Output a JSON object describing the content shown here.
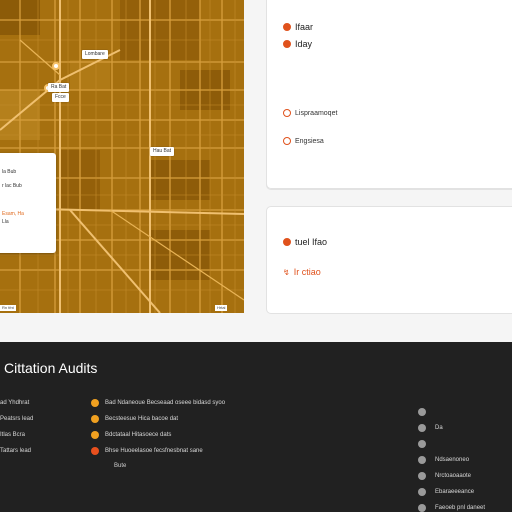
{
  "map": {
    "labels": [
      "Lombare",
      "Ra Bat",
      "Hau Bat",
      "Fcce"
    ],
    "popup": {
      "lines": [
        "la Bub",
        "r lac Bub",
        "Esam, Ha",
        "Lla"
      ]
    },
    "footer": [
      "Rn tfnt",
      "Hrtal"
    ]
  },
  "card1": {
    "items": [
      "Ifaar",
      "Iday"
    ]
  },
  "card2": {
    "items": [
      "Lispraamoqet",
      "Engsiesa"
    ]
  },
  "card3": {
    "items": [
      "tuel Ifao",
      "Ir ctiao"
    ]
  },
  "panel": {
    "title": "Cittation Audits",
    "left_items": [
      "ad Yhdhrat",
      "Peatsrs lead",
      "Itlas Bcra",
      "Tattars lead"
    ],
    "mid_items": [
      {
        "text": "Bad Ndaneoue Becseaad oseee bidasd syoo",
        "color": "orange"
      },
      {
        "text": "Becsteesue Hica bacoe dat",
        "color": "orange"
      },
      {
        "text": "Bdctataal Hitasoece dats",
        "color": "orange"
      },
      {
        "text": "Bhse Huoeelasoe fecsfnesbnat sane",
        "color": "red"
      }
    ],
    "mid_note": "Bute",
    "right_items": [
      "",
      "Da",
      "",
      "Ndsaenoneo",
      "Nrctoaoaaote",
      "Ebaraeeeance",
      "Faeoeb pnl daneet"
    ]
  }
}
